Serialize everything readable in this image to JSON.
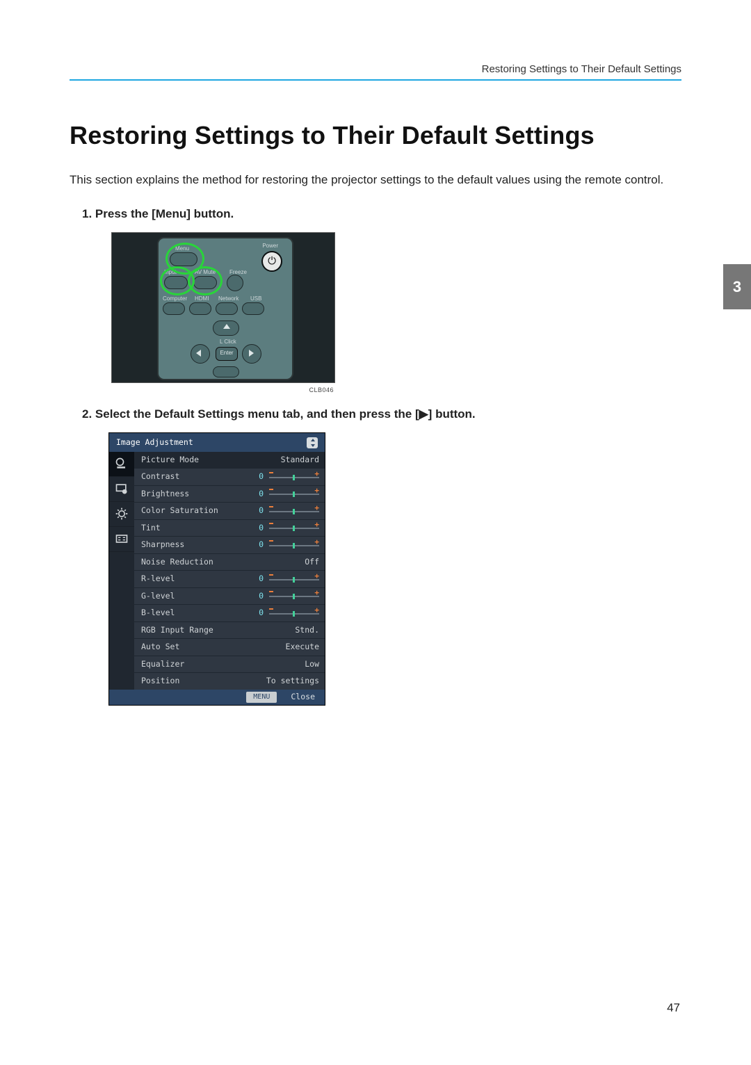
{
  "header": {
    "running_head": "Restoring Settings to Their Default Settings"
  },
  "title": "Restoring Settings to Their Default Settings",
  "intro": "This section explains the method for restoring the projector settings to the default values using the remote control.",
  "steps": {
    "s1_num": "1.",
    "s1_text": "Press the [Menu] button.",
    "s2_num": "2.",
    "s2_text": "Select the Default Settings menu tab, and then press the [▶] button."
  },
  "remote": {
    "labels": {
      "menu": "Menu",
      "power": "Power",
      "input": "Input",
      "avmute": "AV Mute",
      "freeze": "Freeze",
      "computer": "Computer",
      "hdmi": "HDMI",
      "network": "Network",
      "usb": "USB",
      "lclick": "L Click",
      "enter": "Enter"
    },
    "fig_id": "CLB046"
  },
  "osd": {
    "title": "Image Adjustment",
    "rows": [
      {
        "label": "Picture Mode",
        "value": null,
        "text": "Standard",
        "slider": false
      },
      {
        "label": "Contrast",
        "value": "0",
        "text": null,
        "slider": true
      },
      {
        "label": "Brightness",
        "value": "0",
        "text": null,
        "slider": true
      },
      {
        "label": "Color Saturation",
        "value": "0",
        "text": null,
        "slider": true
      },
      {
        "label": "Tint",
        "value": "0",
        "text": null,
        "slider": true
      },
      {
        "label": "Sharpness",
        "value": "0",
        "text": null,
        "slider": true
      },
      {
        "label": "Noise Reduction",
        "value": null,
        "text": "Off",
        "slider": false
      },
      {
        "label": "R-level",
        "value": "0",
        "text": null,
        "slider": true
      },
      {
        "label": "G-level",
        "value": "0",
        "text": null,
        "slider": true
      },
      {
        "label": "B-level",
        "value": "0",
        "text": null,
        "slider": true
      },
      {
        "label": "RGB Input Range",
        "value": null,
        "text": "Stnd.",
        "slider": false
      },
      {
        "label": "Auto Set",
        "value": null,
        "text": "Execute",
        "slider": false
      },
      {
        "label": "Equalizer",
        "value": null,
        "text": "Low",
        "slider": false
      },
      {
        "label": "Position",
        "value": null,
        "text": "To settings",
        "slider": false
      }
    ],
    "footer": {
      "menu": "MENU",
      "close": "Close"
    }
  },
  "chapter_tab": "3",
  "page_number": "47"
}
